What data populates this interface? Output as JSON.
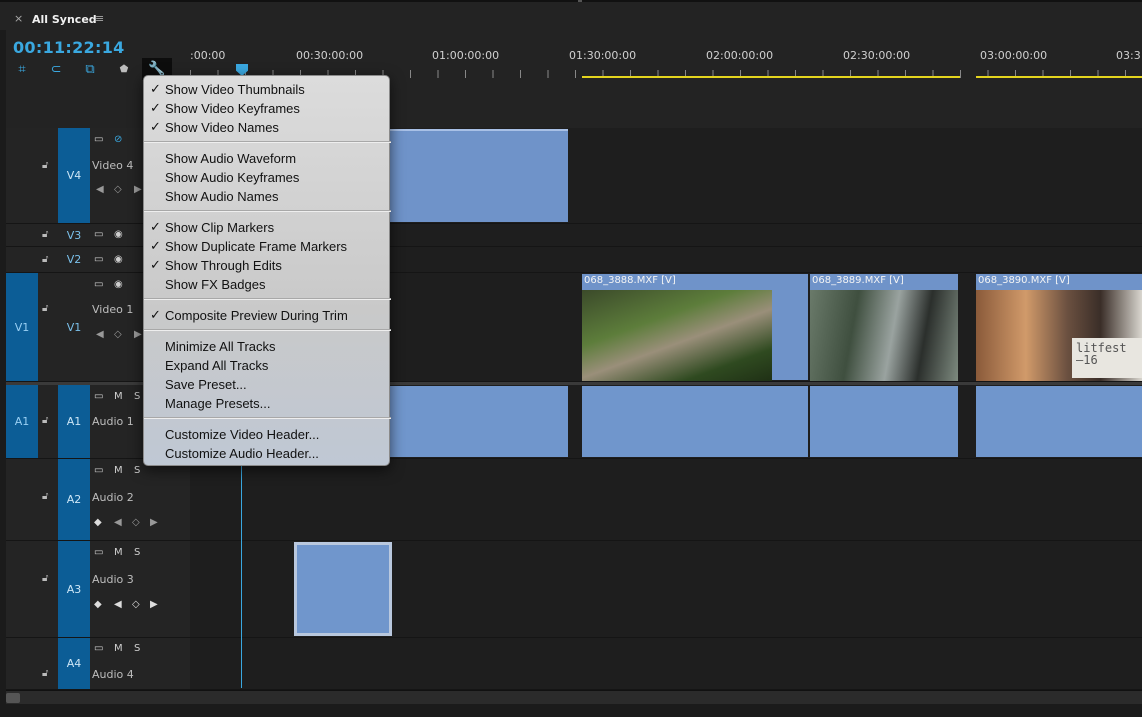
{
  "panel": {
    "close": "×",
    "title": "All Synced",
    "menu": "≡"
  },
  "timecode": "00:11:22:14",
  "ruler": {
    "labels": [
      ":00:00",
      "00:30:00:00",
      "01:00:00:00",
      "01:30:00:00",
      "02:00:00:00",
      "02:30:00:00",
      "03:00:00:00",
      "03:3"
    ]
  },
  "tracks": {
    "v4": {
      "target": "V4",
      "name": "Video 4"
    },
    "v3": {
      "target": "V3"
    },
    "v2": {
      "target": "V2"
    },
    "v1": {
      "source": "V1",
      "target": "V1",
      "name": "Video 1"
    },
    "a1": {
      "source": "A1",
      "target": "A1",
      "name": "Audio 1",
      "m": "M",
      "s": "S"
    },
    "a2": {
      "target": "A2",
      "name": "Audio 2",
      "m": "M",
      "s": "S"
    },
    "a3": {
      "target": "A3",
      "name": "Audio 3",
      "m": "M",
      "s": "S"
    },
    "a4": {
      "target": "A4",
      "name": "Audio 4",
      "m": "M",
      "s": "S"
    }
  },
  "clips": {
    "v1_a": "068_3888.MXF [V]",
    "v1_b": "068_3889.MXF [V]",
    "v1_c": "068_3890.MXF [V]",
    "thumb_text": "litfest\n—16"
  },
  "menu": {
    "items": [
      {
        "label": "Show Video Thumbnails",
        "checked": true
      },
      {
        "label": "Show Video Keyframes",
        "checked": true
      },
      {
        "label": "Show Video Names",
        "checked": true
      },
      {
        "label": "Show Audio Waveform",
        "checked": false
      },
      {
        "label": "Show Audio Keyframes",
        "checked": false
      },
      {
        "label": "Show Audio Names",
        "checked": false
      },
      {
        "label": "Show Clip Markers",
        "checked": true
      },
      {
        "label": "Show Duplicate Frame Markers",
        "checked": true
      },
      {
        "label": "Show Through Edits",
        "checked": true
      },
      {
        "label": "Show FX Badges",
        "checked": false
      },
      {
        "label": "Composite Preview During Trim",
        "checked": true
      },
      {
        "label": "Minimize All Tracks",
        "checked": false
      },
      {
        "label": "Expand All Tracks",
        "checked": false
      },
      {
        "label": "Save Preset...",
        "checked": false
      },
      {
        "label": "Manage Presets...",
        "checked": false
      },
      {
        "label": "Customize Video Header...",
        "checked": false
      },
      {
        "label": "Customize Audio Header...",
        "checked": false
      }
    ],
    "checkmark": "✓"
  },
  "colors": {
    "accent": "#3aa8e0",
    "track_target": "#0c5d96",
    "clip": "#7096cc",
    "timeline_bar": "#e4d41e"
  }
}
